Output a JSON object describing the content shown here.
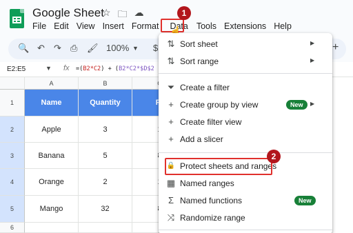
{
  "app": {
    "title": "Google Sheet"
  },
  "header": {
    "icons": [
      "star-icon",
      "folder-move-icon",
      "cloud-status-icon"
    ]
  },
  "menubar": [
    "File",
    "Edit",
    "View",
    "Insert",
    "Format",
    "Data",
    "Tools",
    "Extensions",
    "Help"
  ],
  "badges": {
    "step1": "1",
    "step2": "2"
  },
  "toolbar": {
    "zoom": "100%",
    "currency": "$",
    "plus": "+"
  },
  "formula": {
    "name_box": "E2:E5",
    "fx": "fx",
    "parts": [
      "=(",
      "B2*C2",
      ") + (",
      "B2*C2*$D$2"
    ]
  },
  "sheet": {
    "columns": [
      "A",
      "B",
      "C"
    ],
    "rows": [
      "1",
      "2",
      "3",
      "4",
      "5",
      "6"
    ],
    "header": [
      "Name",
      "Quantity",
      "Pr"
    ],
    "data": [
      [
        "Apple",
        "3",
        "1"
      ],
      [
        "Banana",
        "5",
        "8"
      ],
      [
        "Orange",
        "2",
        "1"
      ],
      [
        "Mango",
        "32",
        "8"
      ]
    ]
  },
  "menu": {
    "items": [
      {
        "icon": "sort-icon",
        "glyph": "⇅",
        "label": "Sort sheet",
        "arrow": "▶"
      },
      {
        "icon": "sort-icon",
        "glyph": "⇅",
        "label": "Sort range",
        "arrow": "▶"
      },
      {
        "icon": "filter-icon",
        "glyph": "⏷",
        "label": "Create a filter"
      },
      {
        "icon": "plus-icon",
        "glyph": "+",
        "label": "Create group by view",
        "badge": "New",
        "arrow": "▶"
      },
      {
        "icon": "plus-icon",
        "glyph": "+",
        "label": "Create filter view"
      },
      {
        "icon": "plus-icon",
        "glyph": "+",
        "label": "Add a slicer"
      },
      {
        "icon": "lock-icon",
        "glyph": "🔒",
        "label": "Protect sheets and ranges"
      },
      {
        "icon": "named-ranges-icon",
        "glyph": "▦",
        "label": "Named ranges"
      },
      {
        "icon": "sigma-icon",
        "glyph": "Σ",
        "label": "Named functions",
        "badge": "New"
      },
      {
        "icon": "shuffle-icon",
        "glyph": "⤨",
        "label": "Randomize range"
      }
    ]
  },
  "colors": {
    "accent_red": "#e0302c",
    "badge_red": "#b2161c",
    "header_blue": "#4a86e8",
    "new_green": "#188038"
  }
}
